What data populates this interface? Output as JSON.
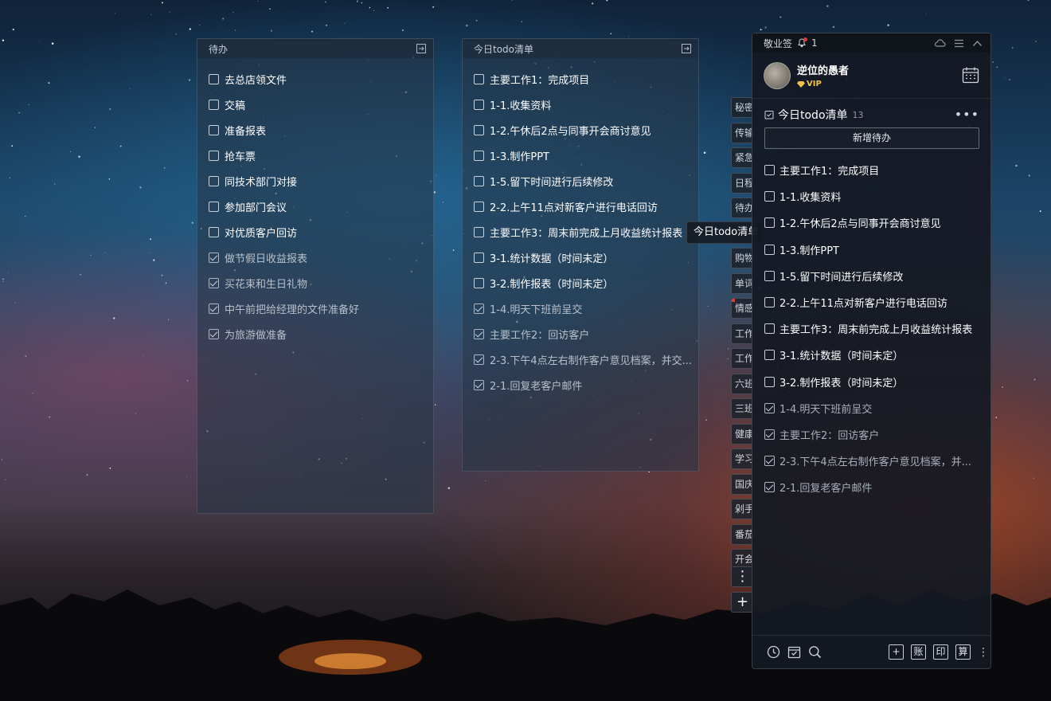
{
  "panels": [
    {
      "title": "待办",
      "items": [
        {
          "text": "去总店领文件",
          "done": false
        },
        {
          "text": "交稿",
          "done": false
        },
        {
          "text": "准备报表",
          "done": false
        },
        {
          "text": "抢车票",
          "done": false
        },
        {
          "text": "同技术部门对接",
          "done": false
        },
        {
          "text": "参加部门会议",
          "done": false
        },
        {
          "text": "对优质客户回访",
          "done": false
        },
        {
          "text": "做节假日收益报表",
          "done": true
        },
        {
          "text": "买花束和生日礼物",
          "done": true
        },
        {
          "text": "中午前把给经理的文件准备好",
          "done": true
        },
        {
          "text": "为旅游做准备",
          "done": true
        }
      ]
    },
    {
      "title": "今日todo清单",
      "items": [
        {
          "text": "主要工作1：完成项目",
          "done": false
        },
        {
          "text": "1-1.收集资料",
          "done": false
        },
        {
          "text": "1-2.午休后2点与同事开会商讨意见",
          "done": false
        },
        {
          "text": "1-3.制作PPT",
          "done": false
        },
        {
          "text": "1-5.留下时间进行后续修改",
          "done": false
        },
        {
          "text": "2-2.上午11点对新客户进行电话回访",
          "done": false
        },
        {
          "text": "主要工作3：周末前完成上月收益统计报表",
          "done": false
        },
        {
          "text": "3-1.统计数据（时间未定）",
          "done": false
        },
        {
          "text": "3-2.制作报表（时间未定）",
          "done": false
        },
        {
          "text": "1-4.明天下班前呈交",
          "done": true
        },
        {
          "text": "主要工作2：回访客户",
          "done": true
        },
        {
          "text": "2-3.下午4点左右制作客户意见档案，并交...",
          "done": true
        },
        {
          "text": "2-1.回复老客户邮件",
          "done": true
        }
      ]
    }
  ],
  "tabs": [
    "秘密",
    "传输",
    "紧急",
    "日程",
    "待办",
    "",
    "购物",
    "单词",
    "情感",
    "工作",
    "工作",
    "六班",
    "三班",
    "健康",
    "学习",
    "国庆",
    "剁手",
    "番茄",
    "开会"
  ],
  "tab_marked_index": 8,
  "tab_more_label": "⋮",
  "tab_add_label": "+",
  "tooltip": "今日todo清单",
  "app": {
    "title": "敬业签",
    "notification_count": "1",
    "user": {
      "name": "逆位的愚者",
      "badge": "VIP"
    },
    "list": {
      "title": "今日todo清单",
      "count": "13",
      "add_button": "新增待办",
      "items": [
        {
          "text": "主要工作1：完成项目",
          "done": false
        },
        {
          "text": "1-1.收集资料",
          "done": false
        },
        {
          "text": "1-2.午休后2点与同事开会商讨意见",
          "done": false
        },
        {
          "text": "1-3.制作PPT",
          "done": false
        },
        {
          "text": "1-5.留下时间进行后续修改",
          "done": false
        },
        {
          "text": "2-2.上午11点对新客户进行电话回访",
          "done": false
        },
        {
          "text": "主要工作3：周末前完成上月收益统计报表",
          "done": false
        },
        {
          "text": "3-1.统计数据（时间未定）",
          "done": false
        },
        {
          "text": "3-2.制作报表（时间未定）",
          "done": false
        },
        {
          "text": "1-4.明天下班前呈交",
          "done": true
        },
        {
          "text": "主要工作2：回访客户",
          "done": true
        },
        {
          "text": "2-3.下午4点左右制作客户意见档案，并...",
          "done": true
        },
        {
          "text": "2-1.回复老客户邮件",
          "done": true
        }
      ]
    },
    "bottom_buttons": [
      "+",
      "账",
      "印",
      "算"
    ]
  },
  "colors": {
    "accent_red": "#e23b3b",
    "vip_gold": "#f1c24a"
  }
}
